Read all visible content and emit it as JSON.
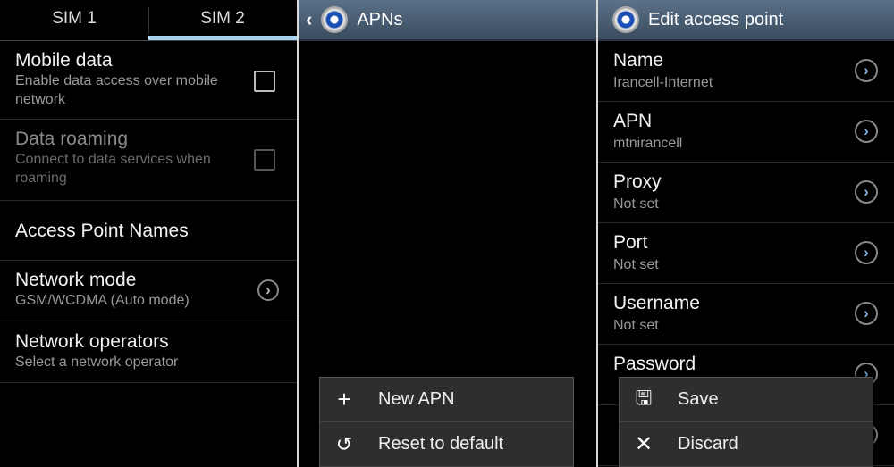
{
  "sim_settings": {
    "tabs": [
      {
        "label": "SIM 1",
        "active": false
      },
      {
        "label": "SIM 2",
        "active": true
      }
    ],
    "accent": "#a7d2f0",
    "mobile_data": {
      "title": "Mobile data",
      "summary": "Enable data access over mobile network",
      "checked": false
    },
    "data_roaming": {
      "title": "Data roaming",
      "summary": "Connect to data services when roaming",
      "checked": false,
      "enabled": false
    },
    "apn": {
      "title": "Access Point Names"
    },
    "network_mode": {
      "title": "Network mode",
      "summary": "GSM/WCDMA (Auto mode)"
    },
    "network_operators": {
      "title": "Network operators",
      "summary": "Select a network operator"
    }
  },
  "apns": {
    "title": "APNs",
    "menu": [
      {
        "icon": "plus-icon",
        "label": "New APN"
      },
      {
        "icon": "reset-icon",
        "label": "Reset to default"
      }
    ]
  },
  "edit_ap": {
    "title": "Edit access point",
    "fields": [
      {
        "label": "Name",
        "value": "Irancell-Internet"
      },
      {
        "label": "APN",
        "value": "mtnirancell"
      },
      {
        "label": "Proxy",
        "value": "Not set"
      },
      {
        "label": "Port",
        "value": "Not set"
      },
      {
        "label": "Username",
        "value": "Not set"
      },
      {
        "label": "Password",
        "value": ""
      }
    ],
    "menu": [
      {
        "icon": "save-icon",
        "label": "Save"
      },
      {
        "icon": "close-icon",
        "label": "Discard"
      }
    ]
  }
}
